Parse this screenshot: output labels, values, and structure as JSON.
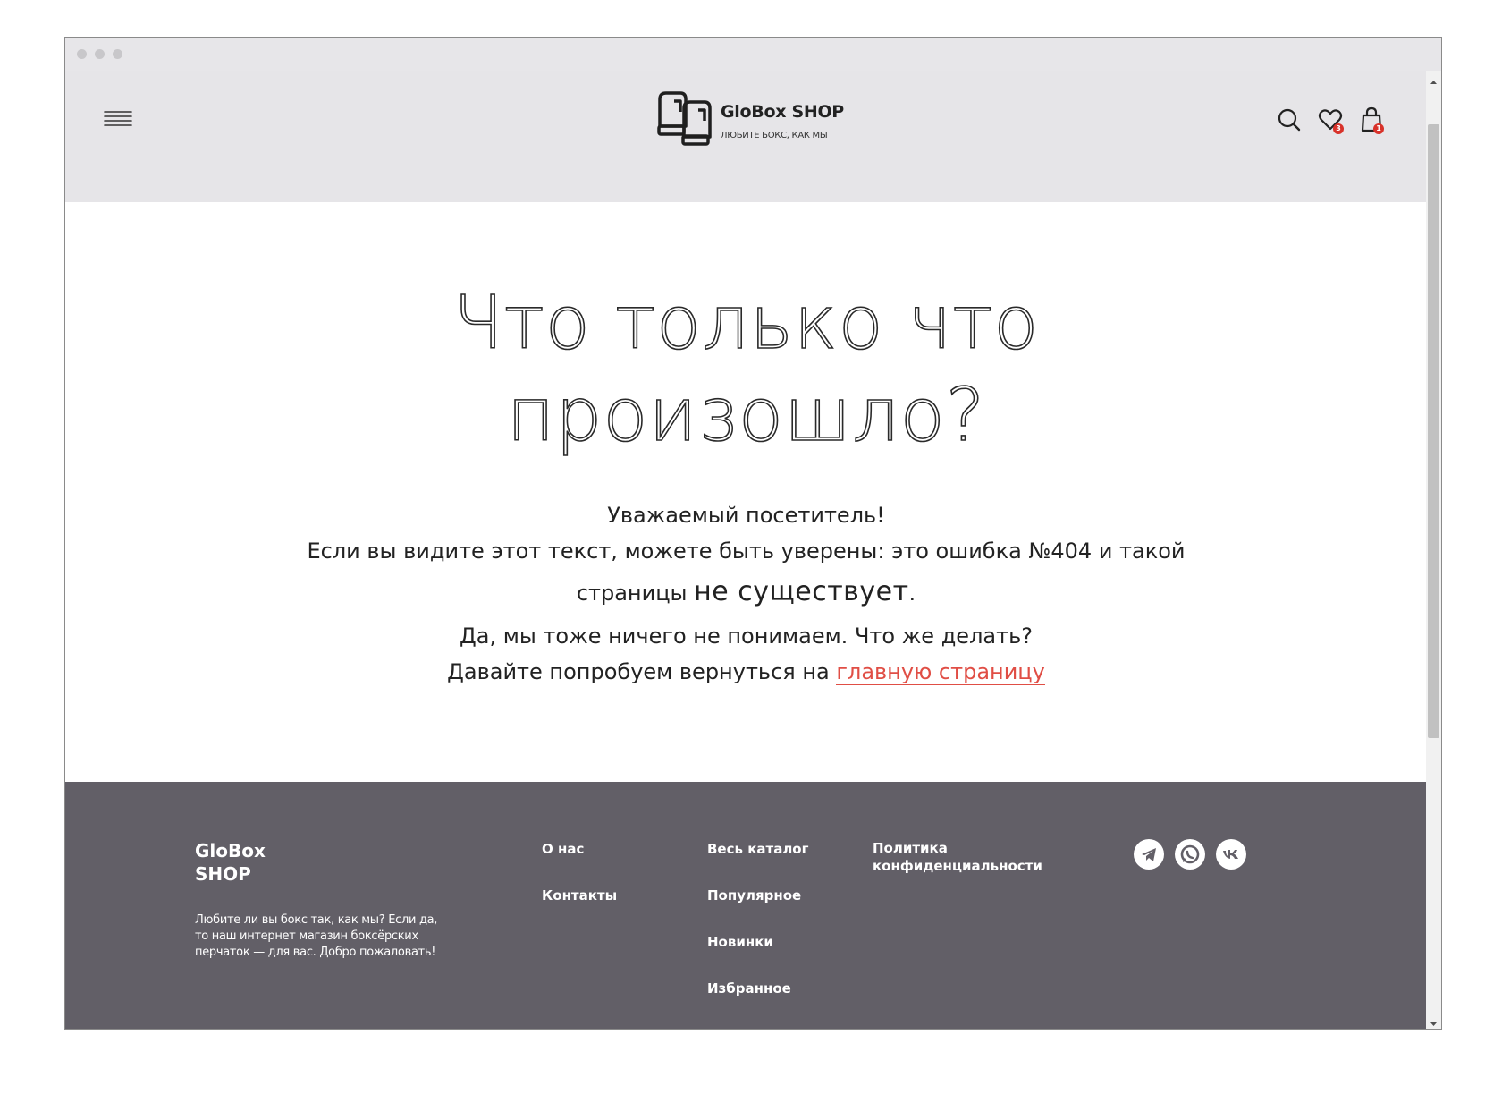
{
  "header": {
    "logo_title": "GloBox SHOP",
    "logo_subtitle": "ЛЮБИТЕ БОКС, КАК МЫ",
    "wishlist_count": "3",
    "cart_count": "1"
  },
  "main": {
    "title_line1": "Что только что",
    "title_line2": "произошло?",
    "greeting": "Уважаемый посетитель!",
    "line2": "Если вы видите этот текст, можете быть уверены: это ошибка №404 и такой",
    "line3_prefix": "страницы ",
    "line3_emphasis": "не существует",
    "line3_suffix": ".",
    "line4": "Да, мы тоже ничего не понимаем. Что же делать?",
    "line5_prefix": "Давайте попробуем вернуться на ",
    "home_link": "главную страницу"
  },
  "footer": {
    "brand": "GloBox SHOP",
    "description": "Любите ли вы бокс так, как мы? Если да, то наш интернет магазин боксёрских перчаток — для вас. Добро пожаловать!",
    "col1": [
      "О нас",
      "Контакты"
    ],
    "col2": [
      "Весь каталог",
      "Популярное",
      "Новинки",
      "Избранное"
    ],
    "col3": [
      "Политика конфиденциальности"
    ],
    "social": [
      "telegram-icon",
      "whatsapp-icon",
      "vk-icon"
    ]
  },
  "colors": {
    "accent_link": "#e04e45",
    "badge": "#d8322a",
    "footer_bg": "#625f67",
    "header_bg": "#e6e5e8"
  }
}
